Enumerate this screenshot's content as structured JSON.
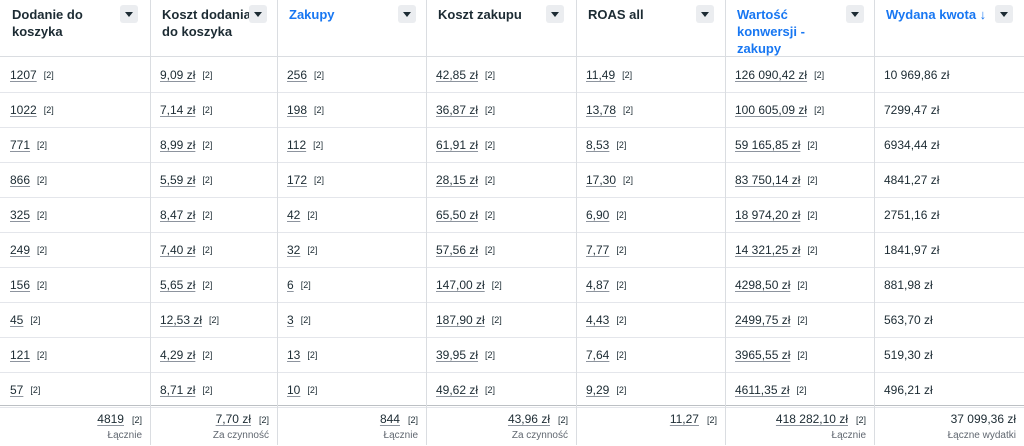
{
  "columns": [
    {
      "title": "Dodanie do koszyka",
      "highlight": false
    },
    {
      "title": "Koszt dodania do koszyka",
      "highlight": false
    },
    {
      "title": "Zakupy",
      "highlight": true
    },
    {
      "title": "Koszt zakupu",
      "highlight": false
    },
    {
      "title": "ROAS all",
      "highlight": false
    },
    {
      "title": "Wartość konwersji - zakupy",
      "highlight": true
    },
    {
      "title": "Wydana kwota ↓",
      "highlight": true
    }
  ],
  "rows": [
    [
      "1207",
      "9,09 zł",
      "256",
      "42,85 zł",
      "11,49",
      "126 090,42 zł",
      "10 969,86 zł"
    ],
    [
      "1022",
      "7,14 zł",
      "198",
      "36,87 zł",
      "13,78",
      "100 605,09 zł",
      "7299,47 zł"
    ],
    [
      "771",
      "8,99 zł",
      "112",
      "61,91 zł",
      "8,53",
      "59 165,85 zł",
      "6934,44 zł"
    ],
    [
      "866",
      "5,59 zł",
      "172",
      "28,15 zł",
      "17,30",
      "83 750,14 zł",
      "4841,27 zł"
    ],
    [
      "325",
      "8,47 zł",
      "42",
      "65,50 zł",
      "6,90",
      "18 974,20 zł",
      "2751,16 zł"
    ],
    [
      "249",
      "7,40 zł",
      "32",
      "57,56 zł",
      "7,77",
      "14 321,25 zł",
      "1841,97 zł"
    ],
    [
      "156",
      "5,65 zł",
      "6",
      "147,00 zł",
      "4,87",
      "4298,50 zł",
      "881,98 zł"
    ],
    [
      "45",
      "12,53 zł",
      "3",
      "187,90 zł",
      "4,43",
      "2499,75 zł",
      "563,70 zł"
    ],
    [
      "121",
      "4,29 zł",
      "13",
      "39,95 zł",
      "7,64",
      "3965,55 zł",
      "519,30 zł"
    ],
    [
      "57",
      "8,71 zł",
      "10",
      "49,62 zł",
      "9,29",
      "4611,35 zł",
      "496,21 zł"
    ]
  ],
  "badge": "[2]",
  "footer": [
    {
      "value": "4819",
      "badge": "[2]",
      "label": "Łącznie"
    },
    {
      "value": "7,70 zł",
      "badge": "[2]",
      "label": "Za czynność"
    },
    {
      "value": "844",
      "badge": "[2]",
      "label": "Łącznie"
    },
    {
      "value": "43,96 zł",
      "badge": "[2]",
      "label": "Za czynność"
    },
    {
      "value": "11,27",
      "badge": "[2]",
      "label": ""
    },
    {
      "value": "418 282,10 zł",
      "badge": "[2]",
      "label": "Łącznie"
    },
    {
      "value": "37 099,36 zł",
      "badge": "",
      "label": "Łączne wydatki"
    }
  ]
}
